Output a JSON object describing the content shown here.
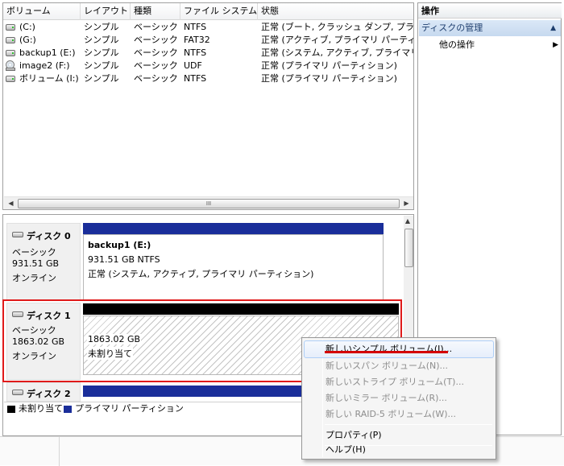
{
  "volume_list": {
    "columns": [
      "ボリューム",
      "レイアウト",
      "種類",
      "ファイル システム",
      "状態"
    ],
    "rows": [
      {
        "icon": "drive-icon",
        "volume": "(C:)",
        "layout": "シンプル",
        "type": "ベーシック",
        "fs": "NTFS",
        "status": "正常 (ブート, クラッシュ ダンプ, プライ"
      },
      {
        "icon": "drive-icon",
        "volume": "(G:)",
        "layout": "シンプル",
        "type": "ベーシック",
        "fs": "FAT32",
        "status": "正常 (アクティブ, プライマリ パーティシ"
      },
      {
        "icon": "drive-icon",
        "volume": "backup1 (E:)",
        "layout": "シンプル",
        "type": "ベーシック",
        "fs": "NTFS",
        "status": "正常 (システム, アクティブ, プライマリ パ"
      },
      {
        "icon": "cd-drive-icon",
        "volume": "image2 (F:)",
        "layout": "シンプル",
        "type": "ベーシック",
        "fs": "UDF",
        "status": "正常 (プライマリ パーティション)"
      },
      {
        "icon": "drive-icon",
        "volume": "ボリューム (I:)",
        "layout": "シンプル",
        "type": "ベーシック",
        "fs": "NTFS",
        "status": "正常 (プライマリ パーティション)"
      }
    ],
    "hscroll_grip": "III"
  },
  "disks": [
    {
      "title": "ディスク 0",
      "kind": "ベーシック",
      "size": "931.51 GB",
      "state": "オンライン",
      "partition": {
        "name": "backup1  (E:)",
        "size_fs": "931.51 GB NTFS",
        "status": "正常 (システム, アクティブ, プライマリ パーティション)"
      }
    },
    {
      "title": "ディスク 1",
      "kind": "ベーシック",
      "size": "1863.02 GB",
      "state": "オンライン",
      "partition": {
        "size": "1863.02 GB",
        "status": "未割り当て"
      }
    },
    {
      "title": "ディスク 2"
    }
  ],
  "legend": {
    "unallocated": "未割り当て",
    "primary": "プライマリ パーティション",
    "colors": {
      "unallocated": "#000000",
      "primary": "#1a2e9a"
    }
  },
  "actions": {
    "title": "操作",
    "section": "ディスクの管理",
    "other": "他の操作"
  },
  "context_menu": {
    "items": [
      {
        "label": "新しいシンプル ボリューム(I)...",
        "enabled": true,
        "highlighted": true
      },
      {
        "label": "新しいスパン ボリューム(N)...",
        "enabled": false
      },
      {
        "label": "新しいストライプ ボリューム(T)...",
        "enabled": false
      },
      {
        "label": "新しいミラー ボリューム(R)...",
        "enabled": false
      },
      {
        "label": "新しい RAID-5 ボリューム(W)...",
        "enabled": false
      },
      {
        "label": "プロパティ(P)",
        "enabled": true
      },
      {
        "label": "ヘルプ(H)",
        "enabled": true
      }
    ]
  },
  "accent_colors": {
    "highlight_box": "#e01a1a",
    "underline": "#d40000"
  }
}
